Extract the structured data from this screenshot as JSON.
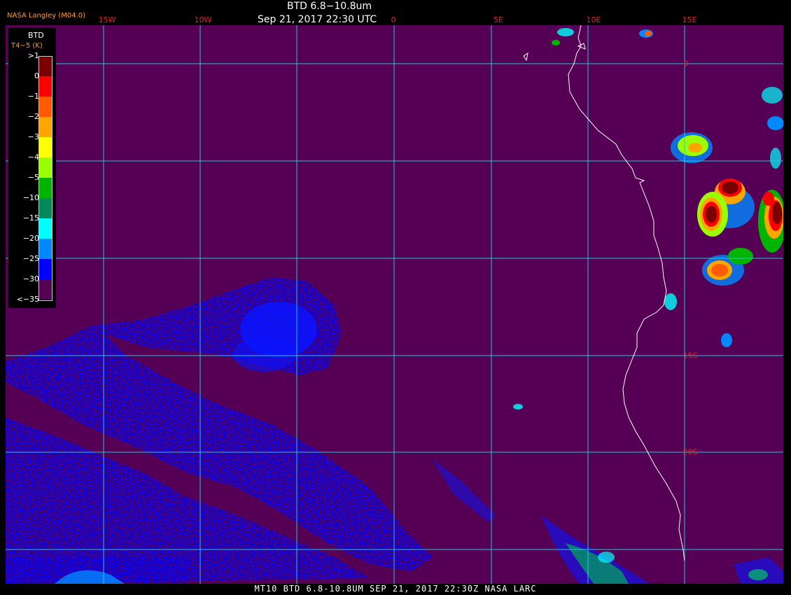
{
  "header": {
    "source": "NASA Langley (M04.0)",
    "title": "BTD 6.8−10.8um",
    "datetime": "Sep 21, 2017 22:30 UTC"
  },
  "longitude_labels": [
    "15W",
    "10W",
    "0",
    "5E",
    "10E",
    "15E"
  ],
  "latitude_labels": [
    "0",
    "15S",
    "20S"
  ],
  "legend": {
    "title": "BTD",
    "subtitle": "T4−5 (K)",
    "labels": [
      ">1",
      "0",
      "−1",
      "−2",
      "−3",
      "−4",
      "−5",
      "−10",
      "−15",
      "−20",
      "−25",
      "−30",
      "<−35"
    ],
    "colors": [
      "#7a0000",
      "#ff0000",
      "#ff5a00",
      "#ffa500",
      "#ffff00",
      "#9aff00",
      "#00b400",
      "#008a5a",
      "#00ffff",
      "#0088ff",
      "#0000ff",
      "#550055"
    ]
  },
  "footer": "MT10  BTD 6.8-10.8UM  SEP 21, 2017 22:30Z  NASA LARC",
  "colors": {
    "background": "#550055",
    "grid": "#20c8d8",
    "coast": "#ffffff",
    "label_red": "#e0252a",
    "label_orange": "#ff9b2b"
  }
}
